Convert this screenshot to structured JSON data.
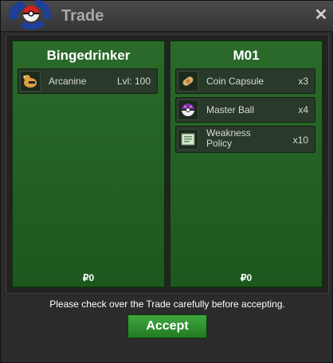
{
  "window": {
    "title": "Trade"
  },
  "left_panel": {
    "player_name": "Bingedrinker",
    "items": [
      {
        "name": "Arcanine",
        "detail": "Lvl: 100",
        "icon": "arcanine-icon"
      }
    ],
    "money_symbol": "₽",
    "money": "0"
  },
  "right_panel": {
    "player_name": "M01",
    "items": [
      {
        "name": "Coin Capsule",
        "qty": "x3",
        "icon": "coin-capsule-icon"
      },
      {
        "name": "Master Ball",
        "qty": "x4",
        "icon": "master-ball-icon"
      },
      {
        "name": "Weakness Policy",
        "qty": "x10",
        "icon": "weakness-policy-icon"
      }
    ],
    "money_symbol": "₽",
    "money": "0"
  },
  "notice": "Please check over the Trade carefully before accepting.",
  "accept_label": "Accept",
  "colors": {
    "panel_green": "#2b6a2b",
    "accept_green": "#2f9a2f"
  }
}
